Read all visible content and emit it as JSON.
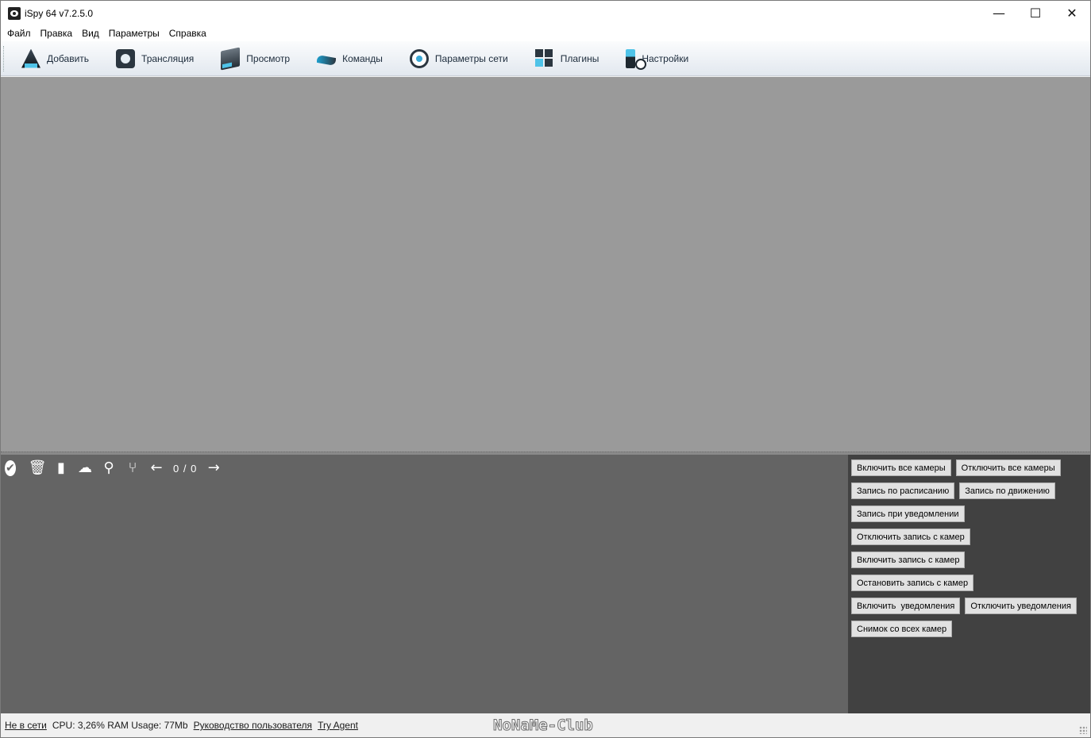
{
  "window": {
    "title": "iSpy 64 v7.2.5.0",
    "controls": {
      "minimize": "—",
      "maximize": "☐",
      "close": "✕"
    }
  },
  "menu": [
    "Файл",
    "Правка",
    "Вид",
    "Параметры",
    "Справка"
  ],
  "toolbar": [
    {
      "label": "Добавить",
      "icon": "add-icon"
    },
    {
      "label": "Трансляция",
      "icon": "stream-icon"
    },
    {
      "label": "Просмотр",
      "icon": "view-icon"
    },
    {
      "label": "Команды",
      "icon": "commands-icon"
    },
    {
      "label": "Параметры сети",
      "icon": "network-icon"
    },
    {
      "label": "Плагины",
      "icon": "plugins-icon"
    },
    {
      "label": "Настройки",
      "icon": "settings-icon"
    }
  ],
  "media_toolbar": {
    "icons": [
      "check-icon",
      "trash-icon",
      "bookmark-icon",
      "cloud-upload-icon",
      "search-icon",
      "merge-icon",
      "arrow-left-icon"
    ],
    "counter": "0 / 0",
    "next_icon": "arrow-right-icon"
  },
  "commands": [
    [
      "Включить все камеры",
      "Отключить все камеры"
    ],
    [
      "Запись по расписанию",
      "Запись по движению"
    ],
    [
      "Запись при уведомлении"
    ],
    [
      "Отключить запись с камер"
    ],
    [
      "Включить запись с камер"
    ],
    [
      "Остановить запись с камер"
    ],
    [
      "Включить  уведомления",
      "Отключить уведомления"
    ],
    [
      "Снимок со всех камер"
    ]
  ],
  "status": {
    "network": "Не в сети",
    "usage": "CPU: 3,26% RAM Usage: 77Mb",
    "manual_link": "Руководство пользователя",
    "agent_link": "Try Agent"
  },
  "watermark": "NoNaMe-Club"
}
